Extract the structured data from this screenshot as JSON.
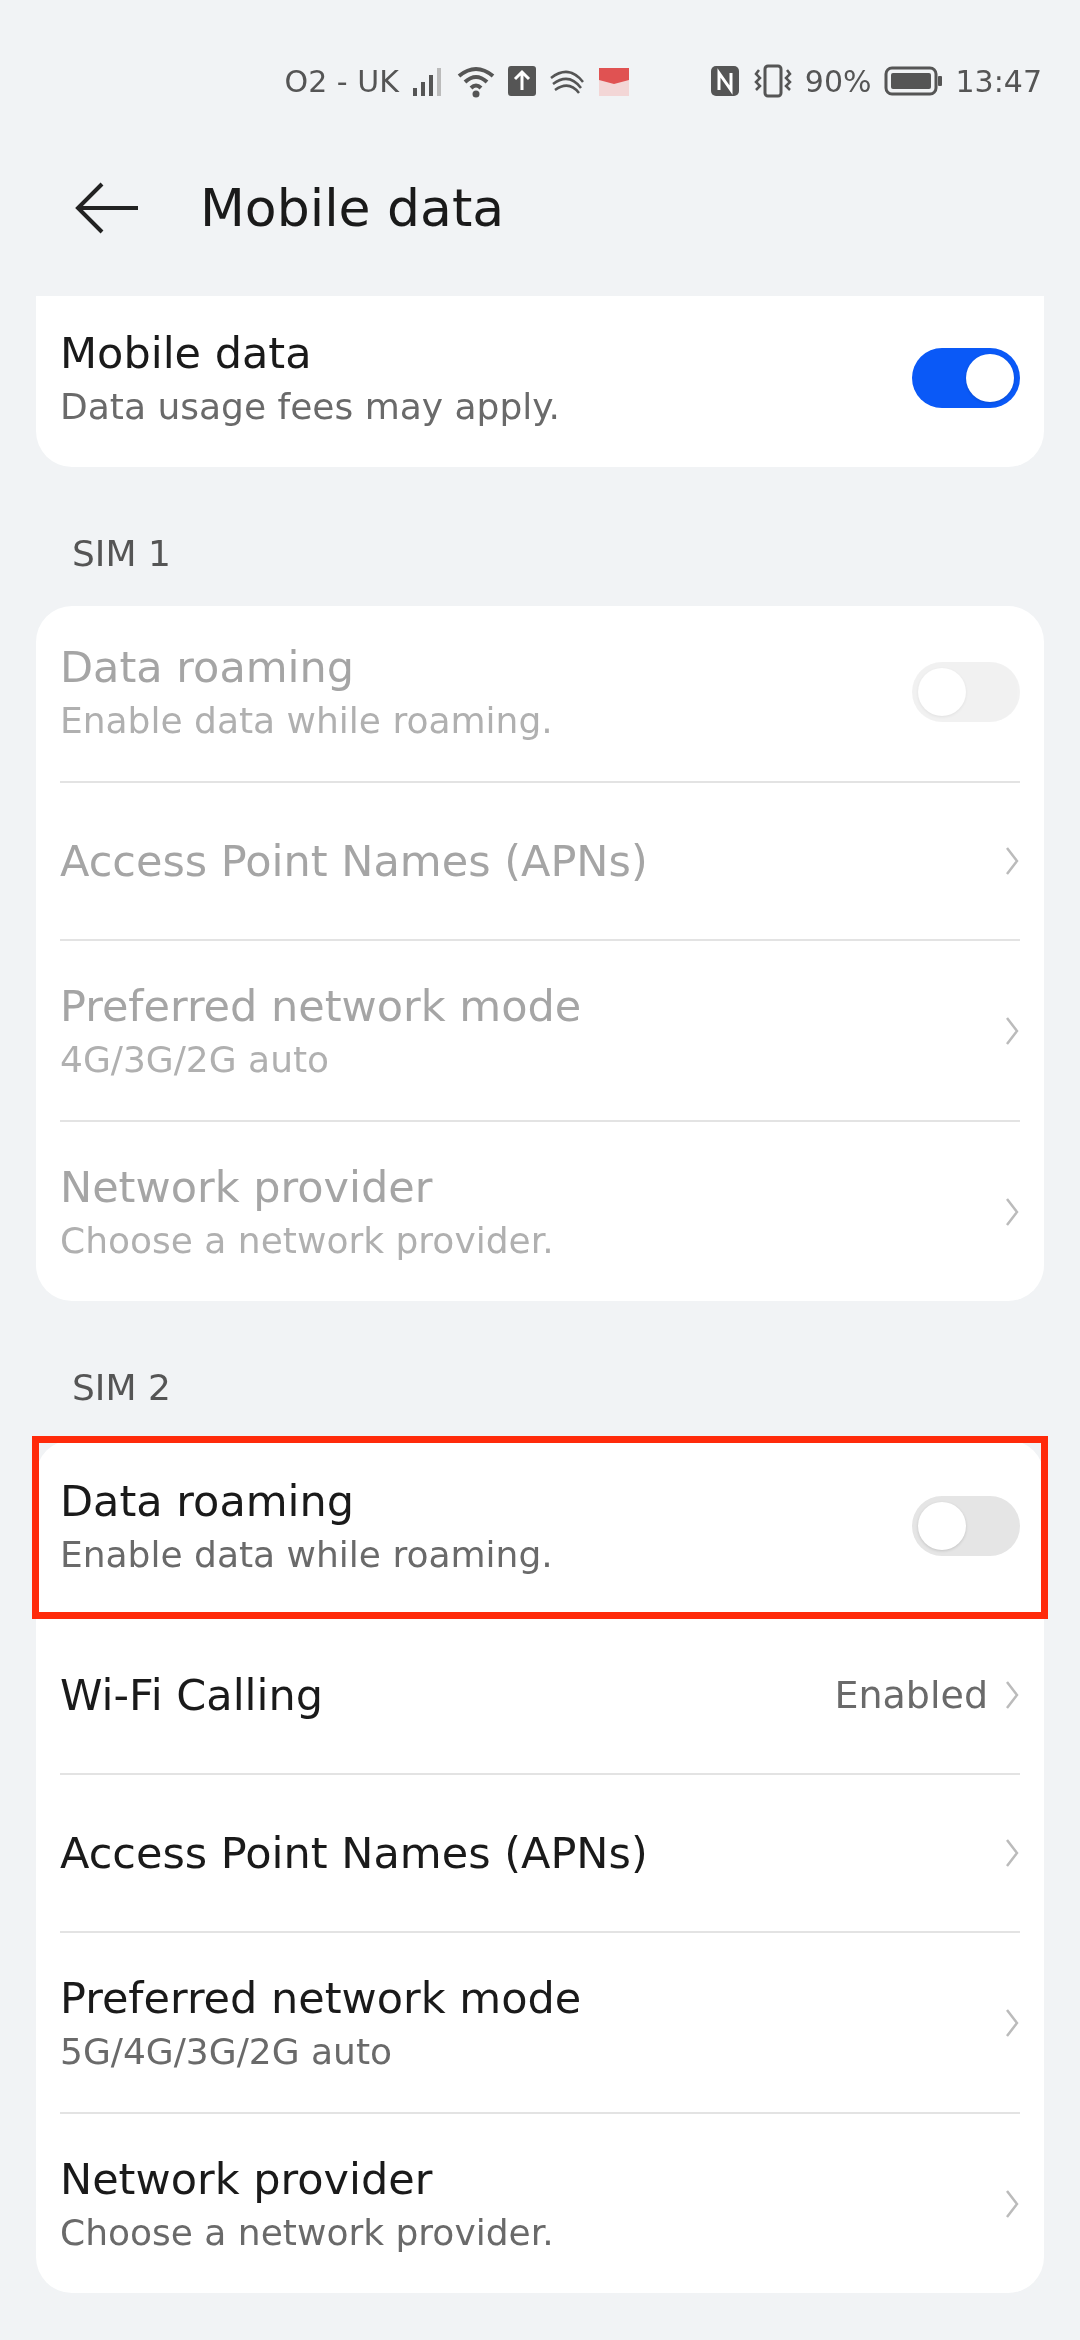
{
  "status_bar": {
    "carrier": "O2 - UK",
    "battery_text": "90%",
    "time": "13:47"
  },
  "header": {
    "title": "Mobile data"
  },
  "sections": [
    {
      "rows": [
        {
          "kind": "toggle",
          "title": "Mobile data",
          "subtitle": "Data usage fees may apply.",
          "on": true,
          "disabled": false
        }
      ]
    },
    {
      "label": "SIM 1",
      "rows": [
        {
          "kind": "toggle",
          "title": "Data roaming",
          "subtitle": "Enable data while roaming.",
          "on": false,
          "disabled": true
        },
        {
          "kind": "link",
          "title": "Access Point Names (APNs)",
          "disabled": true
        },
        {
          "kind": "link",
          "title": "Preferred network mode",
          "subtitle": "4G/3G/2G auto",
          "disabled": true
        },
        {
          "kind": "link",
          "title": "Network provider",
          "subtitle": "Choose a network provider.",
          "disabled": true
        }
      ]
    },
    {
      "label": "SIM 2",
      "rows": [
        {
          "kind": "toggle",
          "title": "Data roaming",
          "subtitle": "Enable data while roaming.",
          "on": false,
          "disabled": false,
          "highlighted": true
        },
        {
          "kind": "link",
          "title": "Wi-Fi Calling",
          "value": "Enabled",
          "disabled": false
        },
        {
          "kind": "link",
          "title": "Access Point Names (APNs)",
          "disabled": false
        },
        {
          "kind": "link",
          "title": "Preferred network mode",
          "subtitle": "5G/4G/3G/2G auto",
          "disabled": false
        },
        {
          "kind": "link",
          "title": "Network provider",
          "subtitle": "Choose a network provider.",
          "disabled": false
        }
      ]
    }
  ]
}
